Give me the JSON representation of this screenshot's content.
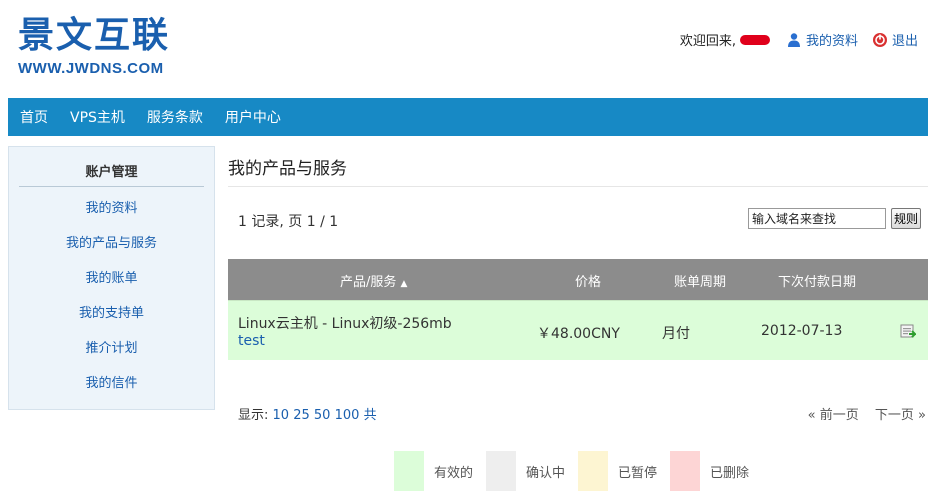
{
  "logo": {
    "title": "景文互联",
    "subtitle": "WWW.JWDNS.COM"
  },
  "user": {
    "welcome": "欢迎回来,",
    "profile": "我的资料",
    "logout": "退出"
  },
  "nav": [
    "首页",
    "VPS主机",
    "服务条款",
    "用户中心"
  ],
  "sidebar": {
    "title": "账户管理",
    "items": [
      "我的资料",
      "我的产品与服务",
      "我的账单",
      "我的支持单",
      "推介计划",
      "我的信件"
    ]
  },
  "main": {
    "title": "我的产品与服务",
    "records": "1 记录, 页 1 / 1",
    "search_value": "输入域名来查找",
    "search_button": "规则"
  },
  "table": {
    "headers": {
      "product": "产品/服务",
      "sort_arrow": "▲",
      "price": "价格",
      "cycle": "账单周期",
      "next_due": "下次付款日期"
    },
    "rows": [
      {
        "product": "Linux云主机 - Linux初级-256mb",
        "domain": "test",
        "price": "￥48.00CNY",
        "cycle": "月付",
        "next_due": "2012-07-13"
      }
    ]
  },
  "display": {
    "label": "显示:",
    "options": [
      "10",
      "25",
      "50",
      "100"
    ],
    "suffix": "共"
  },
  "pager": {
    "prev": "« 前一页",
    "next": "下一页 »"
  },
  "legend": [
    {
      "label": "有效的",
      "color": "#dcfdd9"
    },
    {
      "label": "确认中",
      "color": "#eeeeee"
    },
    {
      "label": "已暂停",
      "color": "#fdf5d2"
    },
    {
      "label": "已删除",
      "color": "#fdd5d5"
    }
  ],
  "colors": {
    "brand": "#1a5fae",
    "nav_bg": "#1789c5",
    "table_header": "#8c8c8c"
  }
}
